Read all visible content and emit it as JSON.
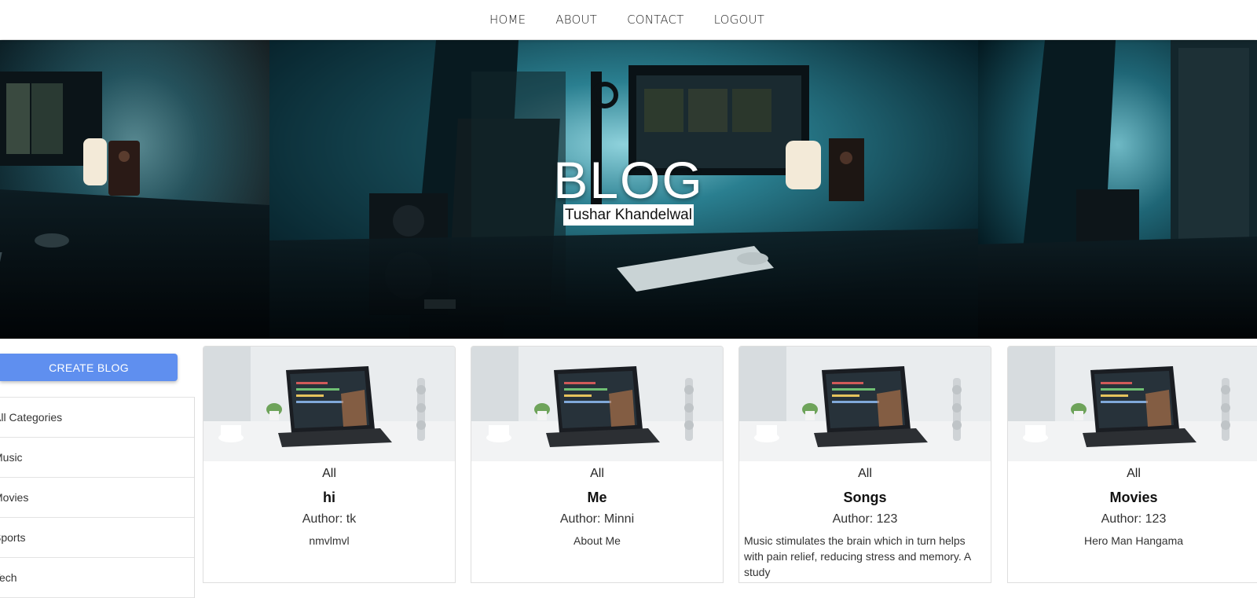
{
  "nav": {
    "links": [
      "HOME",
      "ABOUT",
      "CONTACT",
      "LOGOUT"
    ]
  },
  "hero": {
    "title": "BLOG",
    "subtitle": "Tushar Khandelwal"
  },
  "sidebar": {
    "create_button": "CREATE BLOG",
    "categories": [
      "All Categories",
      "Music",
      "Movies",
      "Sports",
      "Tech"
    ]
  },
  "posts": [
    {
      "category": "All",
      "title": "hi",
      "author": "Author: tk",
      "description": "nmvlmvl"
    },
    {
      "category": "All",
      "title": "Me",
      "author": "Author: Minni",
      "description": "About Me"
    },
    {
      "category": "All",
      "title": "Songs",
      "author": "Author: 123",
      "description": "Music stimulates the brain which in turn helps with pain relief, reducing stress and memory. A study"
    },
    {
      "category": "All",
      "title": "Movies",
      "author": "Author: 123",
      "description": "Hero Man Hangama"
    }
  ],
  "colors": {
    "accent": "#5f8fef",
    "hero_dark": "#04141a",
    "hero_teal": "#2a7f90"
  }
}
